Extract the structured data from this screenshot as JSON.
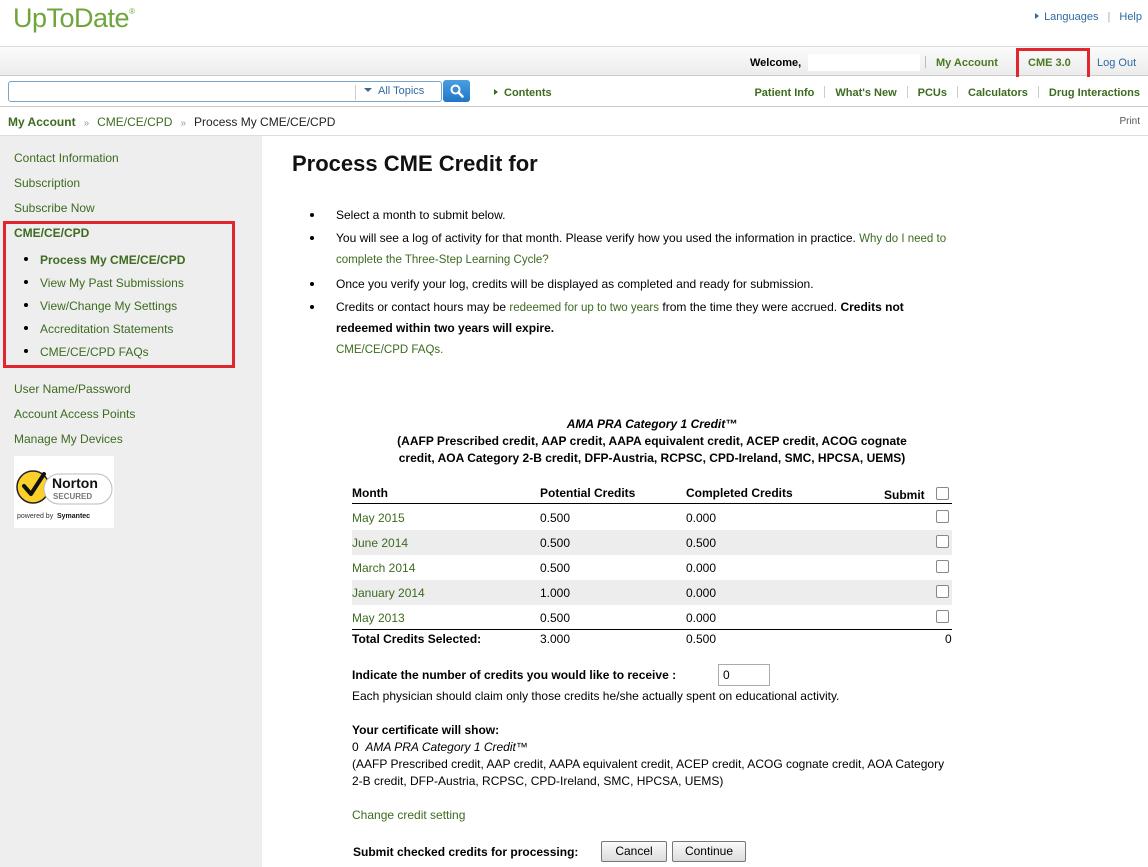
{
  "header": {
    "logo": "UpToDate",
    "logo_mark": "®",
    "languages": "Languages",
    "help": "Help"
  },
  "account_bar": {
    "welcome": "Welcome,",
    "my_account": "My Account",
    "cme": "CME 3.0",
    "log_out": "Log Out"
  },
  "search": {
    "value": "",
    "topic_select": "All Topics",
    "contents": "Contents"
  },
  "nav": [
    "Patient Info",
    "What's New",
    "PCUs",
    "Calculators",
    "Drug Interactions"
  ],
  "breadcrumb": {
    "items": [
      "My Account",
      "CME/CE/CPD",
      "Process My CME/CE/CPD"
    ],
    "separator": "»",
    "print": "Print"
  },
  "sidebar": {
    "top_items": [
      "Contact Information",
      "Subscription",
      "Subscribe Now"
    ],
    "section_head": "CME/CE/CPD",
    "sub_items": [
      "Process My CME/CE/CPD",
      "View My Past Submissions",
      "View/Change My Settings",
      "Accreditation Statements",
      "CME/CE/CPD FAQs"
    ],
    "bottom_items": [
      "User Name/Password",
      "Account Access Points",
      "Manage My Devices"
    ],
    "norton": {
      "brand": "Norton",
      "secured": "SECURED",
      "powered": "powered by",
      "symantec": "Symantec"
    }
  },
  "main": {
    "title": "Process CME Credit for",
    "bullet1": "Select a month to submit below.",
    "bullet2_text": "You will see a log of activity for that month. Please verify how you used the information in practice.",
    "bullet2_link_a": "Why do I need to",
    "bullet2_link_b": "complete the Three-Step Learning Cycle?",
    "bullet3": "Once you verify your log, credits will be displayed as completed and ready for submission.",
    "bullet4_pre": "Credits or contact hours may be",
    "bullet4_link": "redeemed for up to two years",
    "bullet4_mid": "from the time they were accrued.",
    "bullet4_bold_a": "Credits not",
    "bullet4_bold_b": "redeemed within two years will expire.",
    "faq_link": "CME/CE/CPD FAQs."
  },
  "credit_table": {
    "title": "AMA PRA Category 1 Credit™",
    "subtitle_a": "(AAFP Prescribed credit, AAP credit, AAPA equivalent credit, ACEP credit, ACOG cognate",
    "subtitle_b": "credit, AOA Category 2-B credit, DFP-Austria, RCPSC, CPD-Ireland, SMC, HPCSA, UEMS)",
    "headers": {
      "month": "Month",
      "potential": "Potential Credits",
      "completed": "Completed Credits",
      "submit": "Submit"
    },
    "rows": [
      {
        "month": "May 2015",
        "potential": "0.500",
        "completed": "0.000"
      },
      {
        "month": "June 2014",
        "potential": "0.500",
        "completed": "0.500"
      },
      {
        "month": "March 2014",
        "potential": "0.500",
        "completed": "0.000"
      },
      {
        "month": "January 2014",
        "potential": "1.000",
        "completed": "0.000"
      },
      {
        "month": "May 2013",
        "potential": "0.500",
        "completed": "0.000"
      }
    ],
    "total": {
      "label": "Total Credits Selected:",
      "potential": "3.000",
      "completed": "0.500",
      "submit": "0"
    }
  },
  "claim": {
    "label": "Indicate the number of credits you would like to receive :",
    "value": "0",
    "note": "Each physician should claim only those credits he/she actually spent on educational activity."
  },
  "certificate": {
    "head": "Your certificate will show:",
    "count": "0",
    "credit_name": "AMA PRA Category 1 Credit™",
    "detail": "(AAFP Prescribed credit, AAP credit, AAPA equivalent credit, ACEP credit, ACOG cognate credit, AOA Category 2-B credit, DFP-Austria, RCPSC, CPD-Ireland, SMC, HPCSA, UEMS)"
  },
  "actions": {
    "change_setting": "Change credit setting",
    "submit_label": "Submit checked credits for processing:",
    "cancel": "Cancel",
    "continue": "Continue"
  },
  "colors": {
    "accent_green": "#3d6b1f",
    "highlight_red": "#e0262f",
    "link_blue": "#2f6aa3"
  }
}
